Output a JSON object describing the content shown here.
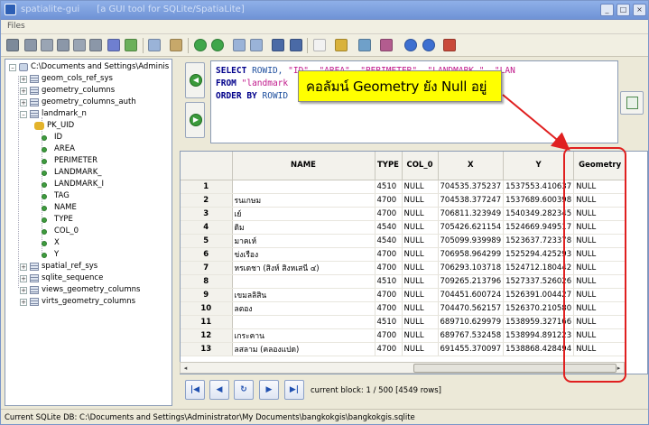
{
  "window": {
    "title": "spatialite-gui",
    "subtitle": "[a GUI tool for SQLite/SpatiaLite]",
    "buttons": [
      "_",
      "□",
      "×"
    ]
  },
  "menu": {
    "files": "Files"
  },
  "tree": {
    "root": "C:\\Documents and Settings\\Adminis",
    "tables_before": [
      "geom_cols_ref_sys",
      "geometry_columns",
      "geometry_columns_auth"
    ],
    "open_table": "landmark_n",
    "columns": [
      "PK_UID",
      "ID",
      "AREA",
      "PERIMETER",
      "LANDMARK_",
      "LANDMARK_I",
      "TAG",
      "NAME",
      "TYPE",
      "COL_0",
      "X",
      "Y"
    ],
    "tables_after": [
      "spatial_ref_sys",
      "sqlite_sequence",
      "views_geometry_columns",
      "virts_geometry_columns"
    ]
  },
  "sql": {
    "line1_kw": "SELECT",
    "line1_rest": "ROWID,",
    "line1_strings": "\"ID\", \"AREA\", \"PERIMETER\", \"LANDMARK_\", \"LAN",
    "line2_kw": "FROM",
    "line2_rest": "\"landmark",
    "line3_kw": "ORDER BY",
    "line3_rest": "ROWID"
  },
  "callout": {
    "text": "คอลัมน์ Geometry ยัง Null อยู่",
    "color": "#ffff00"
  },
  "grid": {
    "headers": [
      "",
      "NAME",
      "TYPE",
      "COL_0",
      "X",
      "Y",
      "Geometry"
    ],
    "rows": [
      [
        "1",
        "",
        "4510",
        "NULL",
        "704535.375237",
        "1537553.410637",
        "NULL"
      ],
      [
        "2",
        "รนเกษม",
        "4700",
        "NULL",
        "704538.377247",
        "1537689.600398",
        "NULL"
      ],
      [
        "3",
        "เย์",
        "4700",
        "NULL",
        "706811.323949",
        "1540349.282345",
        "NULL"
      ],
      [
        "4",
        "ดิม",
        "4540",
        "NULL",
        "705426.621154",
        "1524669.949517",
        "NULL"
      ],
      [
        "5",
        "มาคเห์",
        "4540",
        "NULL",
        "705099.939989",
        "1523637.723378",
        "NULL"
      ],
      [
        "6",
        "ข่งเรือง",
        "4700",
        "NULL",
        "706958.964299",
        "1525294.425293",
        "NULL"
      ],
      [
        "7",
        "หรเดชา (สิงห์ สิงหเสนี ๔)",
        "4700",
        "NULL",
        "706293.103718",
        "1524712.180442",
        "NULL"
      ],
      [
        "8",
        "",
        "4510",
        "NULL",
        "709265.213796",
        "1527337.526026",
        "NULL"
      ],
      [
        "9",
        "เขมลลิสิน",
        "4700",
        "NULL",
        "704451.600724",
        "1526391.004427",
        "NULL"
      ],
      [
        "10",
        "ลตอง",
        "4700",
        "NULL",
        "704470.562157",
        "1526370.210580",
        "NULL"
      ],
      [
        "11",
        "",
        "4510",
        "NULL",
        "689710.629979",
        "1538959.327166",
        "NULL"
      ],
      [
        "12",
        "เกระคาน",
        "4700",
        "NULL",
        "689767.532458",
        "1538994.891223",
        "NULL"
      ],
      [
        "13",
        "ลสลาม (คลองแปด)",
        "4700",
        "NULL",
        "691455.370097",
        "1538868.428494",
        "NULL"
      ]
    ]
  },
  "nav": {
    "first": "|◀",
    "prev": "◀",
    "refresh": "↻",
    "next": "▶",
    "last": "▶|",
    "block_info": "current block: 1 / 500 [4549 rows]"
  },
  "status": {
    "text": "Current SQLite DB: C:\\Documents and Settings\\Administrator\\My Documents\\bangkokgis\\bangkokgis.sqlite"
  },
  "colors": {
    "highlight": "#e02020",
    "callout_bg": "#ffff00"
  }
}
